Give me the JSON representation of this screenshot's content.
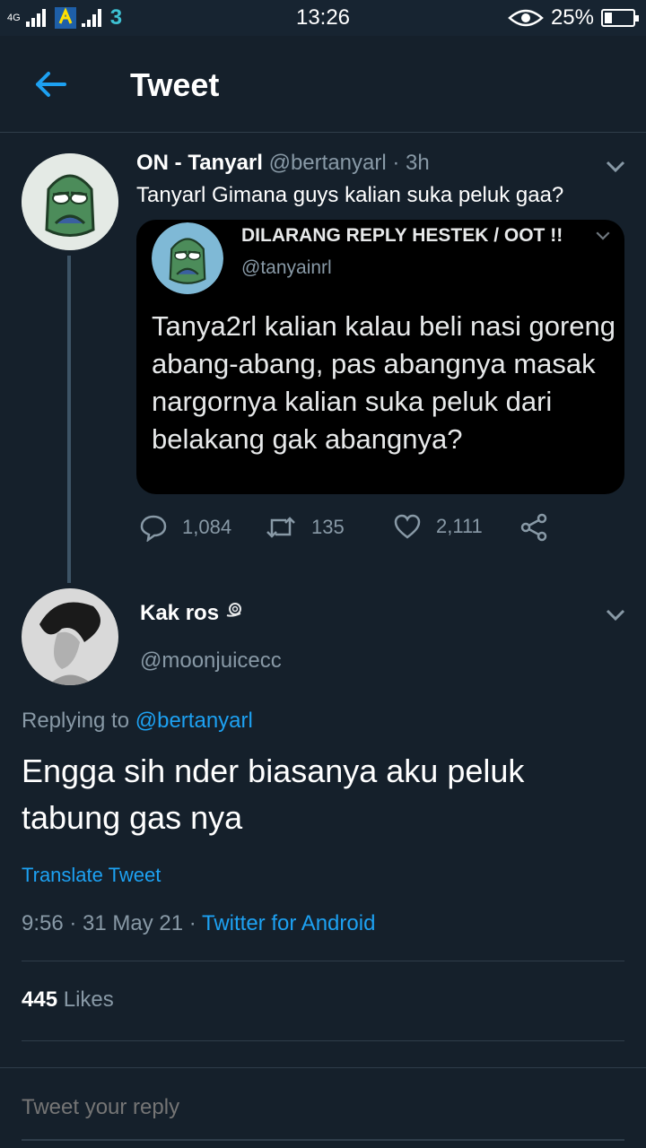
{
  "status_bar": {
    "network_left": "4G",
    "carrier": "3",
    "time": "13:26",
    "battery": "25%",
    "battery_level": 0.25
  },
  "header": {
    "title": "Tweet"
  },
  "parent_tweet": {
    "name": "ON - Tanyarl",
    "handle": "@bertanyarl",
    "time": "3h",
    "separator": "·",
    "text": "Tanyarl Gimana guys kalian suka peluk gaa?",
    "quoted": {
      "name": "DILARANG REPLY HESTEK / OOT !!",
      "handle": "@tanyainrl",
      "text": "Tanya2rl kalian kalau beli nasi goreng abang-abang, pas abangnya masak nargornya kalian suka peluk dari belakang gak abangnya?"
    },
    "actions": {
      "replies": "1,084",
      "retweets": "135",
      "likes": "2,111"
    }
  },
  "main_tweet": {
    "name": "Kak ros",
    "handle": "@moonjuicecc",
    "replying_prefix": "Replying to",
    "replying_handle": "@bertanyarl",
    "text": "Engga sih nder biasanya aku peluk tabung gas nya",
    "translate": "Translate Tweet",
    "time_date": "9:56 · 31 May 21 ·",
    "source": "Twitter for Android",
    "likes_count": "445",
    "likes_label": "Likes"
  },
  "reply": {
    "placeholder": "Tweet your reply"
  },
  "colors": {
    "background": "#15202b",
    "accent": "#1da1f2",
    "muted": "#8899a6"
  }
}
